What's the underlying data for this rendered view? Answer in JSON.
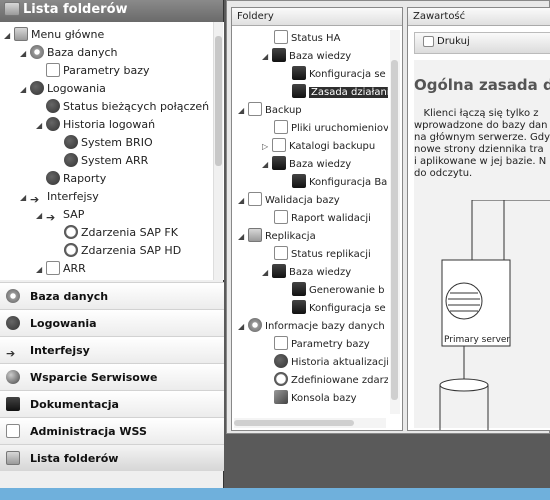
{
  "left": {
    "title": "Lista folderów",
    "tree": [
      {
        "label": "Menu główne",
        "icon": "folder-icon"
      },
      {
        "label": "Baza danych",
        "icon": "gear-icon"
      },
      {
        "label": "Parametry bazy",
        "icon": "document-icon"
      },
      {
        "label": "Logowania",
        "icon": "people-icon"
      },
      {
        "label": "Status bieżących połączeń",
        "icon": "people-icon"
      },
      {
        "label": "Historia logowań",
        "icon": "people-icon"
      },
      {
        "label": "System BRIO",
        "icon": "people-icon"
      },
      {
        "label": "System ARR",
        "icon": "people-icon"
      },
      {
        "label": "Raporty",
        "icon": "people-icon"
      },
      {
        "label": "Interfejsy",
        "icon": "arrow-icon"
      },
      {
        "label": "SAP",
        "icon": "arrow-icon"
      },
      {
        "label": "Zdarzenia SAP FK",
        "icon": "clock-icon"
      },
      {
        "label": "Zdarzenia SAP HD",
        "icon": "clock-icon"
      },
      {
        "label": "ARR",
        "icon": "document-icon"
      }
    ],
    "nav": [
      {
        "label": "Baza danych",
        "icon": "gear-icon"
      },
      {
        "label": "Logowania",
        "icon": "people-icon"
      },
      {
        "label": "Interfejsy",
        "icon": "arrow-icon"
      },
      {
        "label": "Wsparcie Serwisowe",
        "icon": "globe-icon"
      },
      {
        "label": "Dokumentacja",
        "icon": "book-icon"
      },
      {
        "label": "Administracja WSS",
        "icon": "document-icon"
      },
      {
        "label": "Lista folderów",
        "icon": "folder-icon"
      }
    ]
  },
  "folders": {
    "title": "Foldery",
    "items": [
      {
        "label": "Status HA"
      },
      {
        "label": "Baza wiedzy"
      },
      {
        "label": "Konfiguracja se"
      },
      {
        "label": "Zasada działani"
      },
      {
        "label": "Backup"
      },
      {
        "label": "Pliki uruchomieniov"
      },
      {
        "label": "Katalogi backupu"
      },
      {
        "label": "Baza wiedzy"
      },
      {
        "label": "Konfiguracja Ba"
      },
      {
        "label": "Walidacja bazy"
      },
      {
        "label": "Raport walidacji"
      },
      {
        "label": "Replikacja"
      },
      {
        "label": "Status replikacji"
      },
      {
        "label": "Baza wiedzy"
      },
      {
        "label": "Generowanie b"
      },
      {
        "label": "Konfiguracja se"
      },
      {
        "label": "Informacje bazy danych"
      },
      {
        "label": "Parametry bazy"
      },
      {
        "label": "Historia aktualizacji"
      },
      {
        "label": "Zdefiniowane zdarz"
      },
      {
        "label": "Konsola bazy"
      }
    ]
  },
  "content": {
    "title": "Zawartość",
    "print_label": "Drukuj",
    "doc_title": "Ogólna zasada dzia",
    "doc_text": "   Klienci łączą się tylko z\nwprowadzone do bazy dan\nna głównym serwerze. Gdy\nnowe strony dziennika tra\ni aplikowane w jej bazie. N\ndo odczytu.",
    "server_label": "Primary server"
  }
}
